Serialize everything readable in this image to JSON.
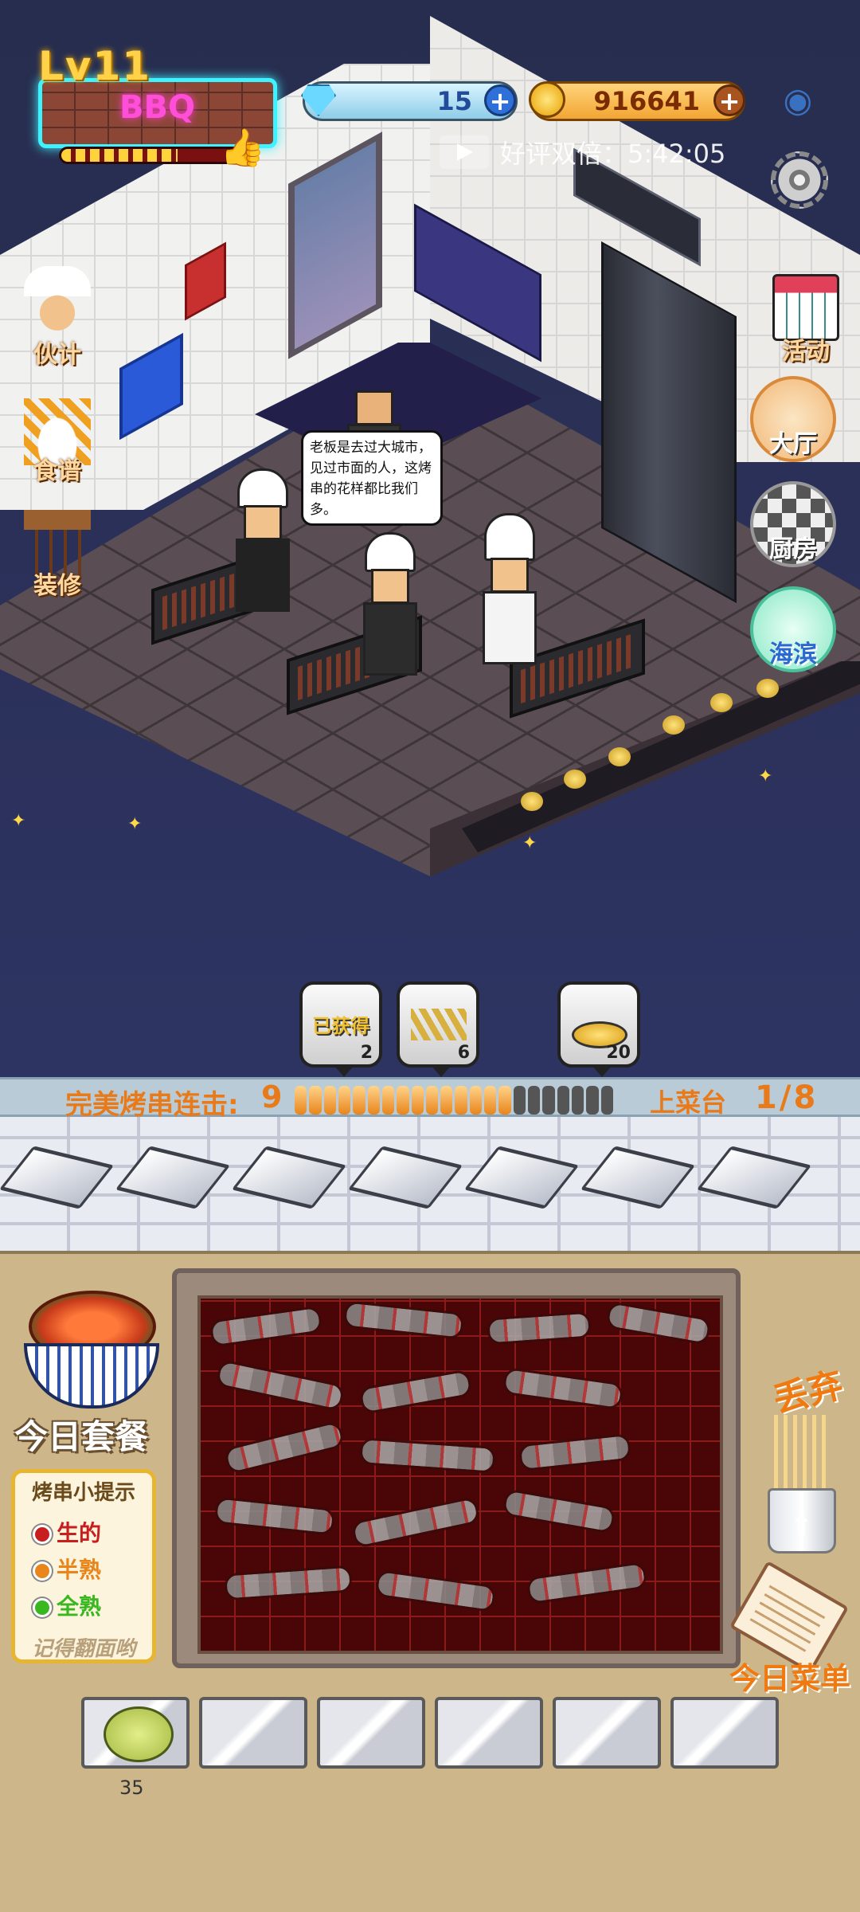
{
  "hud": {
    "level": "Lv11",
    "shop_sign": "BBQ",
    "level_progress": 0.6,
    "gems": "15",
    "coins": "916641",
    "ad_offer": "好评双倍：5:42:05"
  },
  "left_menu": {
    "partners": "伙计",
    "recipes": "食谱",
    "decorate": "装修"
  },
  "right_menu": {
    "events": "活动",
    "hall": "大厅",
    "kitchen": "厨房",
    "beach": "海滨"
  },
  "speech_bubble": "老板是去过大城市，见过市面的人，这烤串的花样都比我们多。",
  "orders": [
    {
      "label": "已获得",
      "count": "2"
    },
    {
      "label": "",
      "count": "6"
    },
    {
      "label": "",
      "count": "20"
    }
  ],
  "combo": {
    "label": "完美烤串连击:",
    "value": "9",
    "filled_ticks": 15,
    "total_ticks": 22,
    "station_label": "上菜台",
    "station_count": "1/8"
  },
  "bottom": {
    "today_combo": "今日套餐",
    "tips_title": "烤串小提示",
    "tips": [
      {
        "label": "生的",
        "color": "#c81e1e"
      },
      {
        "label": "半熟",
        "color": "#e8861c"
      },
      {
        "label": "全熟",
        "color": "#38b81e"
      }
    ],
    "tips_footer": "记得翻面哟",
    "discard": "丢弃",
    "today_menu": "今日菜单",
    "inventory_count": "35"
  },
  "colors": {
    "accent_orange": "#e87a1a",
    "neon_cyan": "#3ef3ff",
    "neon_pink": "#ff4fd8"
  }
}
